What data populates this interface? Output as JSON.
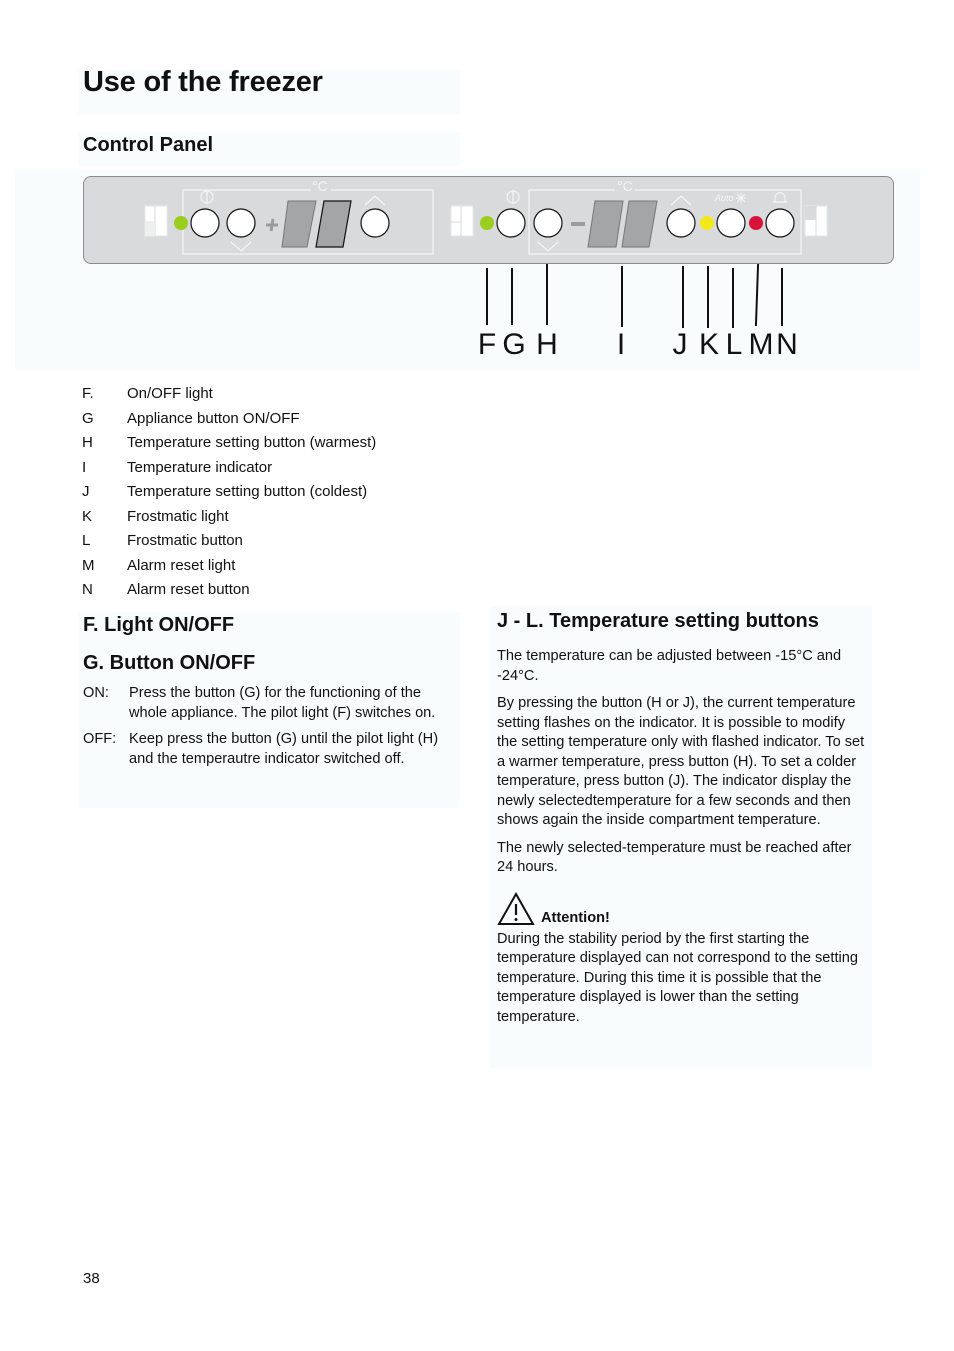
{
  "page": {
    "title": "Use of the freezer",
    "page_number": "38"
  },
  "control_panel": {
    "heading": "Control Panel",
    "temp_unit_left": "°C",
    "temp_unit_right": "°C",
    "auto_label": "Auto",
    "plus_sign": "+",
    "minus_sign": "−",
    "light_colors": {
      "on_off_left": "#9acd1e",
      "on_off_right": "#9acd1e",
      "frostmatic": "#f2e81a",
      "alarm": "#d8123a"
    },
    "callouts": [
      "F",
      "G",
      "H",
      "I",
      "J",
      "K",
      "L",
      "M",
      "N"
    ]
  },
  "legend": [
    {
      "key": "F.",
      "label": "On/OFF light"
    },
    {
      "key": "G",
      "label": "Appliance button ON/OFF"
    },
    {
      "key": "H",
      "label": "Temperature setting button (warmest)"
    },
    {
      "key": "I",
      "label": "Temperature indicator"
    },
    {
      "key": "J",
      "label": "Temperature setting button (coldest)"
    },
    {
      "key": "K",
      "label": "Frostmatic light"
    },
    {
      "key": "L",
      "label": "Frostmatic button"
    },
    {
      "key": "M",
      "label": "Alarm reset light"
    },
    {
      "key": "N",
      "label": "Alarm reset button"
    }
  ],
  "left_section": {
    "heading_f": "F. Light ON/OFF",
    "heading_g": "G. Button ON/OFF",
    "items": [
      {
        "key": "ON:",
        "text": "Press the button (G) for the functioning of the whole appliance. The pilot light (F) switches on."
      },
      {
        "key": "OFF:",
        "text": "Keep press the button (G) until the pilot light (H) and the temperautre indicator switched off."
      }
    ]
  },
  "right_section": {
    "heading": "J - L. Temperature setting buttons",
    "paragraphs": [
      "The temperature can be adjusted between -15°C and -24°C.",
      "By pressing the button (H or J), the current temperature setting flashes on the indicator. It is possible to modify the setting temperature only with flashed indicator. To set a warmer temperature, press button (H). To set a colder temperature, press button (J). The indicator display the newly selectedtemperature for a few seconds and then shows again the inside compartment temperature.",
      "The newly selected-temperature must be reached after 24 hours."
    ],
    "attention_label": "Attention!",
    "attention_text": "During the stability period by the first starting the temperature displayed can not correspond to the setting temperature. During this time it is possible that the temperature displayed is lower than the setting temperature."
  }
}
